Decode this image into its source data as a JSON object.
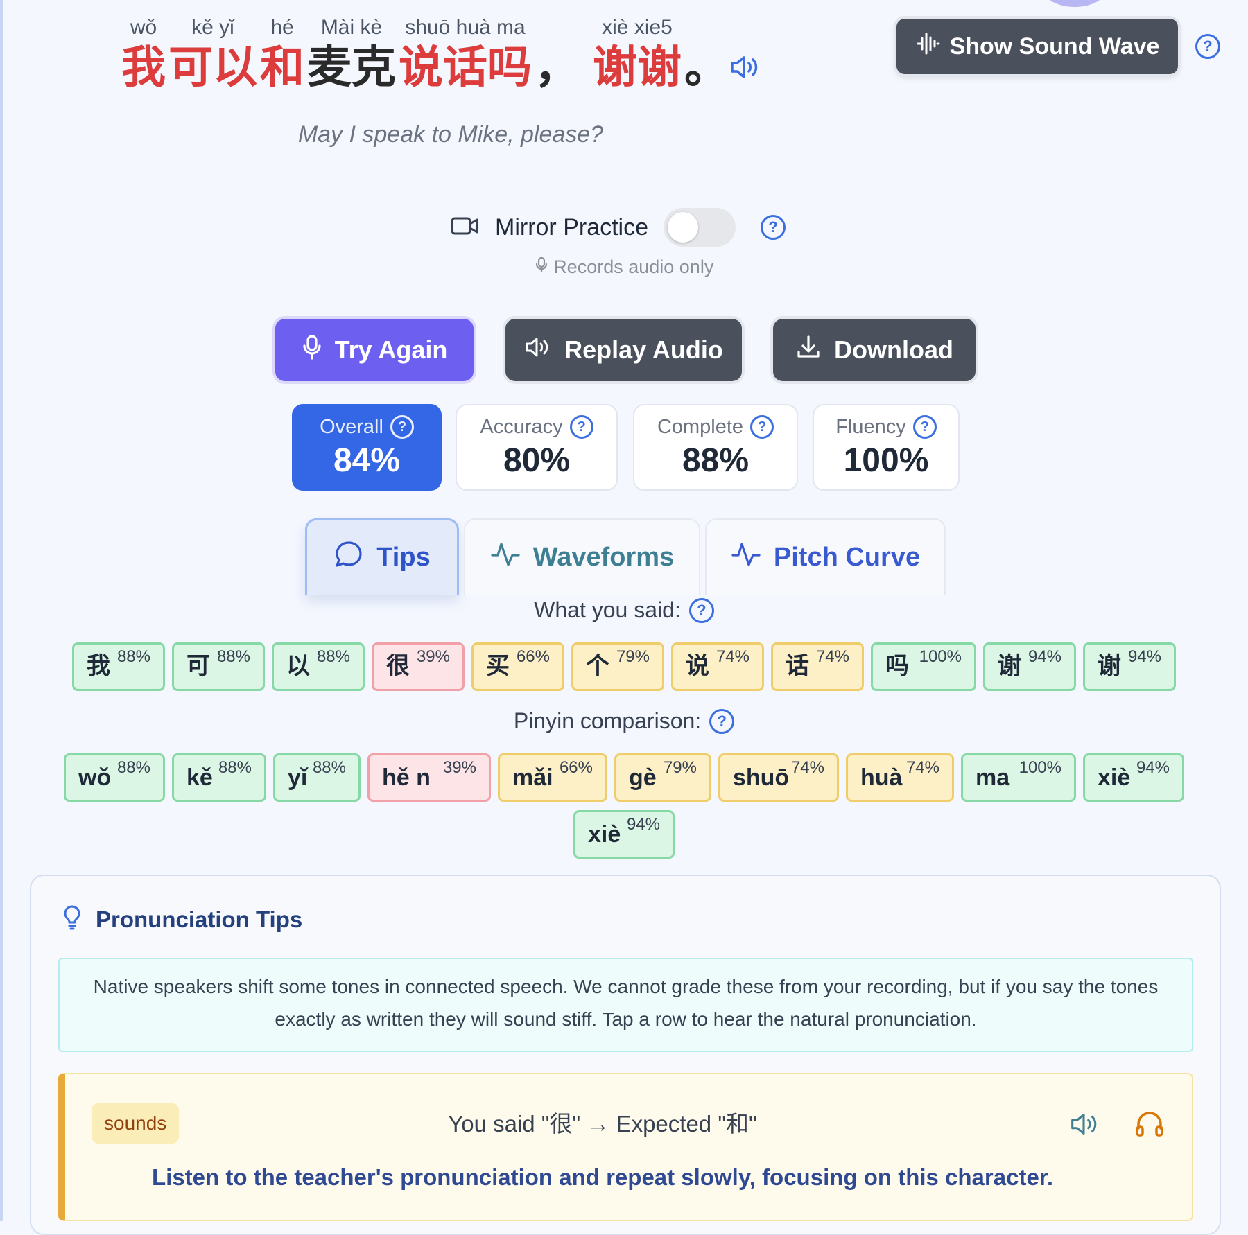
{
  "sentence": {
    "tokens": [
      {
        "pinyin": "wǒ",
        "hanzi": "我",
        "color": "red"
      },
      {
        "pinyin": "kě yǐ",
        "hanzi": "可以",
        "color": "red"
      },
      {
        "pinyin": "hé",
        "hanzi": "和",
        "color": "red"
      },
      {
        "pinyin": "Mài kè",
        "hanzi": "麦克",
        "color": "dark"
      },
      {
        "pinyin": "shuō huà ma",
        "hanzi": "说话吗",
        "color": "red"
      },
      {
        "pinyin": "",
        "hanzi": "，",
        "color": "dark"
      },
      {
        "pinyin": "xiè xie5",
        "hanzi": "谢谢",
        "color": "red"
      },
      {
        "pinyin": "",
        "hanzi": "。",
        "color": "dark"
      }
    ],
    "translation": "May I speak to Mike, please?"
  },
  "sound_wave_button": {
    "label": "Show Sound Wave"
  },
  "mirror": {
    "label": "Mirror Practice",
    "enabled": false,
    "note": "Records audio only"
  },
  "actions": {
    "try_again": "Try Again",
    "replay": "Replay Audio",
    "download": "Download"
  },
  "scores": {
    "overall": {
      "label": "Overall",
      "value": "84%"
    },
    "accuracy": {
      "label": "Accuracy",
      "value": "80%"
    },
    "complete": {
      "label": "Complete",
      "value": "88%"
    },
    "fluency": {
      "label": "Fluency",
      "value": "100%"
    }
  },
  "tabs": {
    "tips": "Tips",
    "waveforms": "Waveforms",
    "pitch": "Pitch Curve",
    "active": "tips"
  },
  "said": {
    "title": "What you said:",
    "chips": [
      {
        "text": "我",
        "pct": "88%",
        "level": "good"
      },
      {
        "text": "可",
        "pct": "88%",
        "level": "good"
      },
      {
        "text": "以",
        "pct": "88%",
        "level": "good"
      },
      {
        "text": "很",
        "pct": "39%",
        "level": "bad"
      },
      {
        "text": "买",
        "pct": "66%",
        "level": "fair"
      },
      {
        "text": "个",
        "pct": "79%",
        "level": "fair"
      },
      {
        "text": "说",
        "pct": "74%",
        "level": "fair"
      },
      {
        "text": "话",
        "pct": "74%",
        "level": "fair"
      },
      {
        "text": "吗",
        "pct": "100%",
        "level": "good"
      },
      {
        "text": "谢",
        "pct": "94%",
        "level": "good"
      },
      {
        "text": "谢",
        "pct": "94%",
        "level": "good"
      }
    ]
  },
  "pinyin": {
    "title": "Pinyin comparison:",
    "chips_row1": [
      {
        "text": "wǒ",
        "pct": "88%",
        "level": "good"
      },
      {
        "text": "kě",
        "pct": "88%",
        "level": "good"
      },
      {
        "text": "yǐ",
        "pct": "88%",
        "level": "good"
      },
      {
        "text": "hě n",
        "pct": "39%",
        "level": "bad"
      },
      {
        "text": "mǎi",
        "pct": "66%",
        "level": "fair"
      },
      {
        "text": "gè",
        "pct": "79%",
        "level": "fair"
      },
      {
        "text": "shuō",
        "pct": "74%",
        "level": "fair"
      },
      {
        "text": "huà",
        "pct": "74%",
        "level": "fair"
      },
      {
        "text": "ma",
        "pct": "100%",
        "level": "good"
      },
      {
        "text": "xiè",
        "pct": "94%",
        "level": "good"
      }
    ],
    "chips_row2": [
      {
        "text": "xiè",
        "pct": "94%",
        "level": "good"
      }
    ]
  },
  "tips": {
    "title": "Pronunciation Tips",
    "info": "Native speakers shift some tones in connected speech. We cannot grade these from your recording, but if you say the tones exactly as written they will sound stiff. Tap a row to hear the natural pronunciation.",
    "issue": {
      "badge": "sounds",
      "text": "You said \"很\" → Expected \"和\"",
      "advice": "Listen to the teacher's pronunciation and repeat slowly, focusing on this character."
    }
  },
  "colors": {
    "accent": "#3467e6",
    "try_again": "#6d5ff0",
    "dark_button": "#4a515d",
    "good": "#dcf6e5",
    "fair": "#fdf0c6",
    "bad": "#fde4e6"
  }
}
